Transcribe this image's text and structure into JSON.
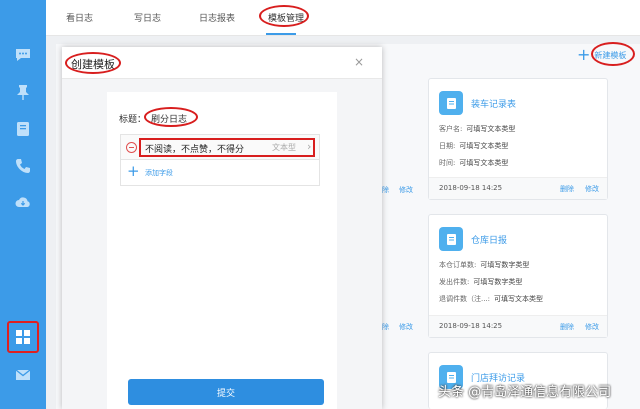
{
  "sidebar": {
    "icons": [
      "chat-icon",
      "pin-icon",
      "notebook-icon",
      "phone-icon",
      "cloud-icon",
      "apps-grid-icon",
      "mail-icon"
    ],
    "accent_color": "#3c9be8"
  },
  "tabs": [
    {
      "label": "看日志"
    },
    {
      "label": "写日志"
    },
    {
      "label": "日志报表"
    },
    {
      "label": "模板管理",
      "active": true
    }
  ],
  "toolbar": {
    "new_template_label": "新建模板"
  },
  "cards": [
    {
      "title": "装车记录表",
      "fields": [
        {
          "label": "客户名:",
          "value": "可填写文本类型"
        },
        {
          "label": "日期:",
          "value": "可填写文本类型"
        },
        {
          "label": "时间:",
          "value": "可填写文本类型"
        }
      ],
      "date": "2018-09-18 14:25",
      "delete_label": "删除",
      "edit_label": "修改"
    },
    {
      "title": "仓库日报",
      "fields": [
        {
          "label": "本仓订单数:",
          "value": "可填写数字类型"
        },
        {
          "label": "发出件数:",
          "value": "可填写数字类型"
        },
        {
          "label": "退调件数（注...:",
          "value": "可填写文本类型"
        }
      ],
      "date": "2018-09-18 14:25",
      "delete_label": "删除",
      "edit_label": "修改"
    },
    {
      "title": "门店拜访记录"
    }
  ],
  "background_actions": {
    "row1": "修改",
    "row2": "修改"
  },
  "modal": {
    "title": "创建模板",
    "close": "×",
    "title_label": "标题：",
    "title_value": "刷分日志",
    "field_name": "不阅读，不点赞，不得分",
    "field_type": "文本型",
    "add_field_label": "添加字段",
    "submit_label": "提交"
  },
  "watermark": "头条 @青岛泽通信息有限公司",
  "annotation_color": "#d81e1e"
}
